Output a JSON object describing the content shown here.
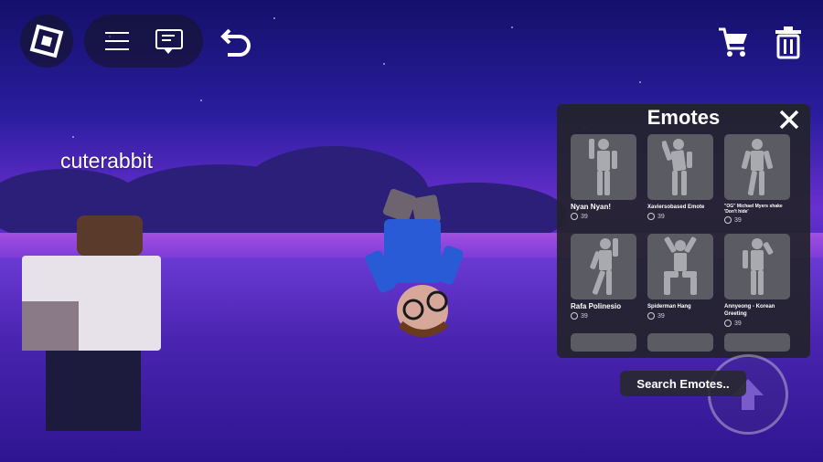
{
  "player": {
    "username": "cuterabbit"
  },
  "topbar": {
    "roblox_icon": "roblox-logo-icon",
    "menu_icon": "hamburger-menu-icon",
    "chat_icon": "chat-icon",
    "undo_icon": "undo-icon",
    "cart_icon": "cart-icon",
    "trash_icon": "trash-icon"
  },
  "emotes": {
    "title": "Emotes",
    "close_icon": "close-icon",
    "items": [
      {
        "name": "Nyan Nyan!",
        "price": "39"
      },
      {
        "name": "Xaviersobased Emote",
        "price": "39"
      },
      {
        "name": "\"OG\" Michael Myers shake 'Don't hide'",
        "price": "39"
      },
      {
        "name": "Rafa Polinesio",
        "price": "39"
      },
      {
        "name": "Spiderman Hang",
        "price": "39"
      },
      {
        "name": "Annyeong - Korean Greeting",
        "price": "39"
      }
    ],
    "search_label": "Search Emotes.."
  },
  "colors": {
    "panel_bg": "#23232a",
    "thumb_bg": "#5b5b63",
    "sky_purple": "#6a2fd0"
  }
}
